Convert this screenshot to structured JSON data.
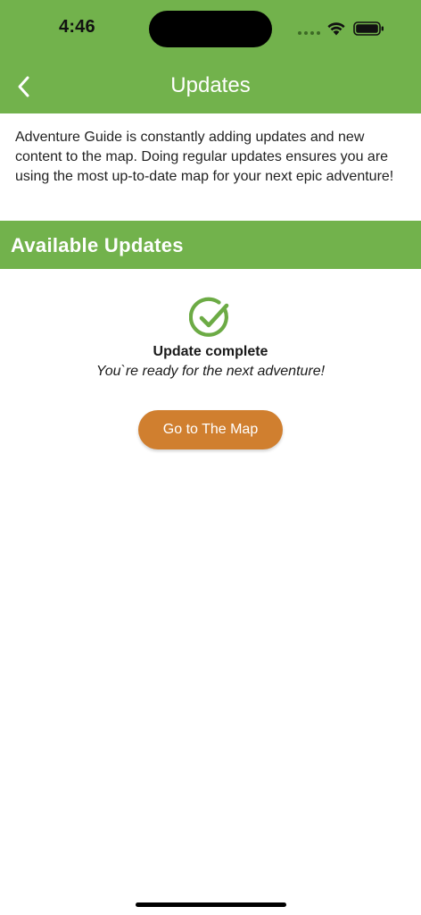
{
  "status_bar": {
    "time": "4:46",
    "icons": [
      "signal-dots-icon",
      "wifi-icon",
      "battery-icon"
    ]
  },
  "nav": {
    "title": "Updates",
    "back_icon": "chevron-left-icon"
  },
  "intro_text": "Adventure Guide is constantly adding updates and new content to the map. Doing regular updates ensures you are using the most up-to-date map for your next epic adventure!",
  "section": {
    "title": "Available Updates"
  },
  "update_status": {
    "icon": "check-circle-icon",
    "title": "Update complete",
    "subtitle": "You`re ready for the next adventure!"
  },
  "actions": {
    "go_to_map_label": "Go to The Map"
  },
  "colors": {
    "header_green": "#72b24c",
    "button_orange": "#d07f2f",
    "check_green": "#6cab45"
  }
}
